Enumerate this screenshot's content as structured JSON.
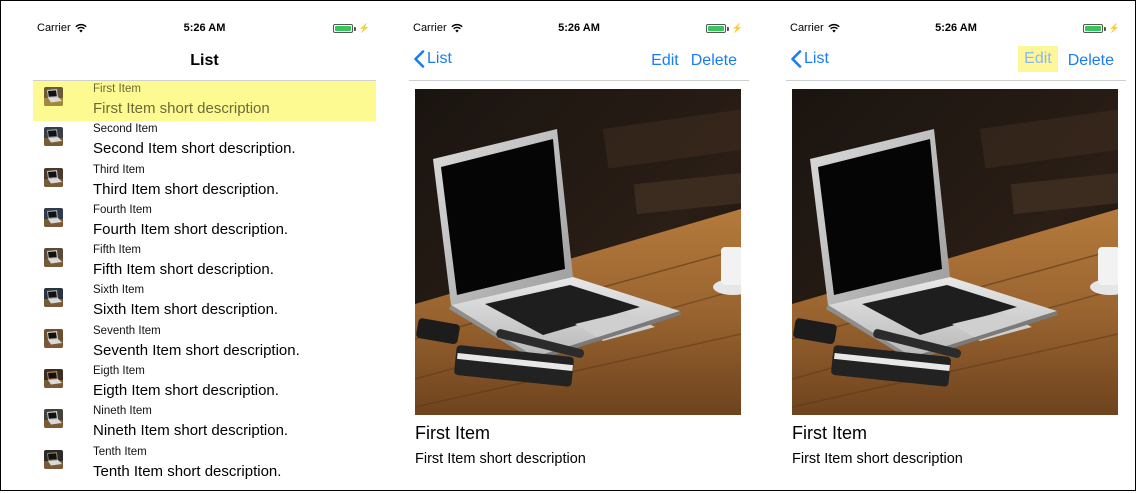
{
  "status": {
    "carrier": "Carrier",
    "time": "5:26 AM"
  },
  "list_screen": {
    "title": "List",
    "items": [
      {
        "title": "First Item",
        "description": "First Item short description"
      },
      {
        "title": "Second Item",
        "description": "Second Item short description."
      },
      {
        "title": "Third Item",
        "description": "Third Item short description."
      },
      {
        "title": "Fourth Item",
        "description": "Fourth Item short description."
      },
      {
        "title": "Fifth Item",
        "description": "Fifth Item short description."
      },
      {
        "title": "Sixth Item",
        "description": "Sixth Item short description."
      },
      {
        "title": "Seventh Item",
        "description": "Seventh Item short description."
      },
      {
        "title": "Eigth Item",
        "description": "Eigth Item short description."
      },
      {
        "title": "Nineth Item",
        "description": "Nineth Item short description."
      },
      {
        "title": "Tenth Item",
        "description": "Tenth Item short description."
      }
    ]
  },
  "detail_screen": {
    "back_label": "List",
    "edit_label": "Edit",
    "delete_label": "Delete",
    "item_title": "First Item",
    "item_description": "First Item short description"
  },
  "colors": {
    "accent": "#1a7cf5",
    "highlight": "#fdfa91",
    "battery": "#35c759"
  }
}
